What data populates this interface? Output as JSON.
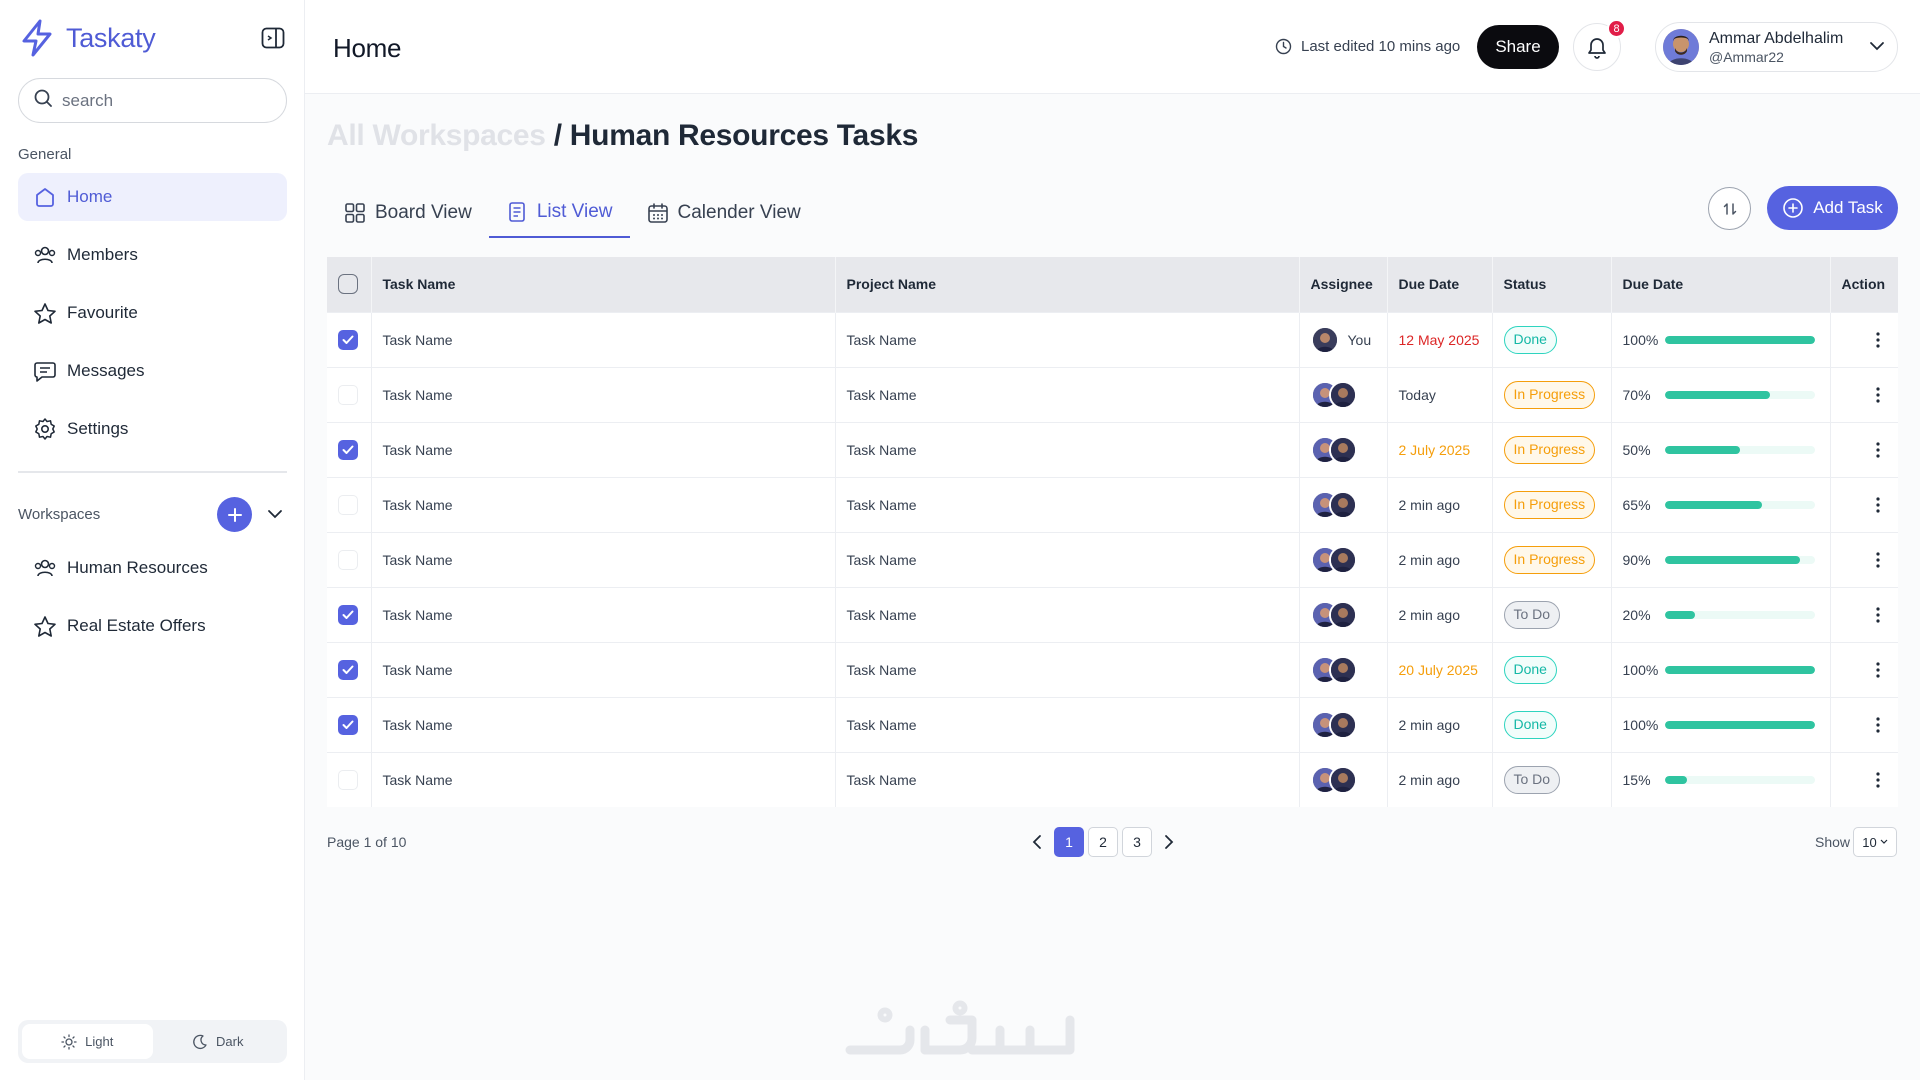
{
  "brand": {
    "name": "Taskaty",
    "accent": "#5662e0"
  },
  "sidebar": {
    "search_placeholder": "search",
    "general_label": "General",
    "nav": [
      {
        "label": "Home",
        "icon": "home-icon",
        "active": true
      },
      {
        "label": "Members",
        "icon": "users-icon"
      },
      {
        "label": "Favourite",
        "icon": "star-icon"
      },
      {
        "label": "Messages",
        "icon": "message-icon"
      },
      {
        "label": "Settings",
        "icon": "gear-icon"
      }
    ],
    "workspaces_label": "Workspaces",
    "workspaces": [
      {
        "label": "Human Resources",
        "icon": "users-icon"
      },
      {
        "label": "Real Estate Offers",
        "icon": "star-icon"
      }
    ],
    "theme": {
      "light": "Light",
      "dark": "Dark",
      "selected": "Light"
    }
  },
  "header": {
    "title": "Home",
    "last_edited": "Last edited 10 mins ago",
    "share_label": "Share",
    "notifications_count": "8",
    "user": {
      "name": "Ammar Abdelhalim",
      "handle": "@Ammar22"
    }
  },
  "main": {
    "breadcrumb_root": "All Workspaces",
    "breadcrumb_current": "/ Human Resources Tasks",
    "tabs": [
      {
        "label": "Board View",
        "icon": "grid-icon"
      },
      {
        "label": "List View",
        "icon": "list-icon",
        "active": true
      },
      {
        "label": "Calender View",
        "icon": "calendar-icon"
      }
    ],
    "add_task_label": "Add Task"
  },
  "table": {
    "columns": [
      "Task Name",
      "Project Name",
      "Assignee",
      "Due Date",
      "Status",
      "Due Date",
      "Action"
    ],
    "rows": [
      {
        "checked": true,
        "task": "Task Name",
        "project": "Task Name",
        "assignee": "You",
        "due": "12 May 2025",
        "due_color": "red",
        "status": "Done",
        "status_type": "done",
        "progress": "100%",
        "progress_value": 100
      },
      {
        "checked": false,
        "task": "Task Name",
        "project": "Task Name",
        "assignee": "",
        "due": "Today",
        "due_color": "",
        "status": "In Progress",
        "status_type": "progress",
        "progress": "70%",
        "progress_value": 70
      },
      {
        "checked": true,
        "task": "Task Name",
        "project": "Task Name",
        "assignee": "",
        "due": "2 July 2025",
        "due_color": "orange",
        "status": "In Progress",
        "status_type": "progress",
        "progress": "50%",
        "progress_value": 50
      },
      {
        "checked": false,
        "task": "Task Name",
        "project": "Task Name",
        "assignee": "",
        "due": "2 min ago",
        "due_color": "",
        "status": "In Progress",
        "status_type": "progress",
        "progress": "65%",
        "progress_value": 65
      },
      {
        "checked": false,
        "task": "Task Name",
        "project": "Task Name",
        "assignee": "",
        "due": "2 min ago",
        "due_color": "",
        "status": "In Progress",
        "status_type": "progress",
        "progress": "90%",
        "progress_value": 90
      },
      {
        "checked": true,
        "task": "Task Name",
        "project": "Task Name",
        "assignee": "",
        "due": "2 min ago",
        "due_color": "",
        "status": "To Do",
        "status_type": "todo",
        "progress": "20%",
        "progress_value": 20
      },
      {
        "checked": true,
        "task": "Task Name",
        "project": "Task Name",
        "assignee": "",
        "due": "20 July 2025",
        "due_color": "orange",
        "status": "Done",
        "status_type": "done",
        "progress": "100%",
        "progress_value": 100
      },
      {
        "checked": true,
        "task": "Task Name",
        "project": "Task Name",
        "assignee": "",
        "due": "2 min ago",
        "due_color": "",
        "status": "Done",
        "status_type": "done",
        "progress": "100%",
        "progress_value": 100
      },
      {
        "checked": false,
        "task": "Task Name",
        "project": "Task Name",
        "assignee": "",
        "due": "2 min ago",
        "due_color": "",
        "status": "To Do",
        "status_type": "todo",
        "progress": "15%",
        "progress_value": 15
      }
    ]
  },
  "pagination": {
    "info": "Page 1 of 10",
    "pages": [
      "1",
      "2",
      "3"
    ],
    "current": "1",
    "show_label": "Show",
    "show_value": "10"
  },
  "watermark": "خمسات"
}
